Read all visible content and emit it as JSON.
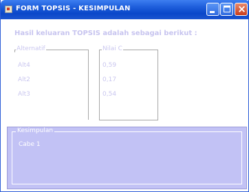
{
  "window": {
    "title": "FORM TOPSIS - KESIMPULAN",
    "icon": "app-icon",
    "controls": {
      "minimize_icon": "minimize-icon",
      "maximize_icon": "maximize-icon",
      "close_icon": "close-icon",
      "close_glyph": "×"
    }
  },
  "header": {
    "text": "Hasil keluaran TOPSIS adalah sebagai berikut :"
  },
  "table": {
    "columns": [
      "Alternatif",
      "Nilai C"
    ],
    "rows": [
      {
        "alternatif": "Alt4",
        "nilai": "0,59"
      },
      {
        "alternatif": "Alt2",
        "nilai": "0,17"
      },
      {
        "alternatif": "Alt3",
        "nilai": "0,54"
      }
    ]
  },
  "conclusion": {
    "label": "Kesimpulan",
    "text": "Cabe 1"
  },
  "colors": {
    "titlebar": "#1f5fdc",
    "text_faded": "#c9c6ef",
    "conclusion_bg": "#c2c2f5"
  }
}
